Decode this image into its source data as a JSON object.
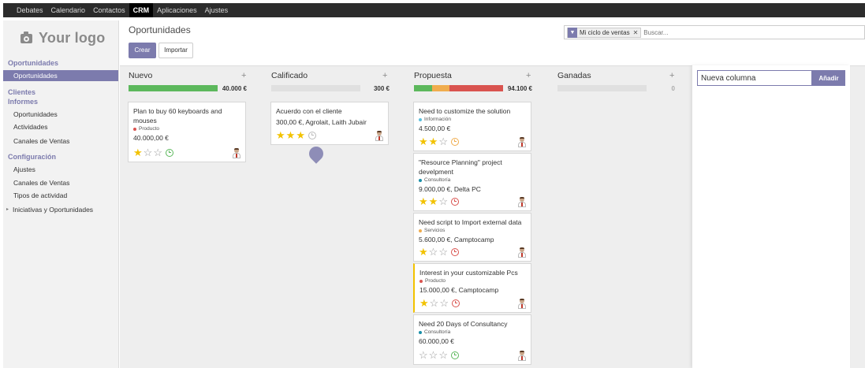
{
  "topnav": {
    "items": [
      "Debates",
      "Calendario",
      "Contactos",
      "CRM",
      "Aplicaciones",
      "Ajustes"
    ],
    "active": "CRM"
  },
  "sidebar": {
    "logo_text": "Your logo",
    "sections": {
      "oportunidades": "Oportunidades",
      "clientes": "Clientes",
      "informes": "Informes",
      "configuracion": "Configuración"
    },
    "active_item": "Oportunidades",
    "informes_items": [
      "Oportunidades",
      "Actividades",
      "Canales de Ventas"
    ],
    "config_items": [
      "Ajustes",
      "Canales de Ventas",
      "Tipos de actividad"
    ],
    "expandable_item": "Iniciativas y Oportunidades"
  },
  "header": {
    "title": "Oportunidades",
    "create_label": "Crear",
    "import_label": "Importar"
  },
  "search": {
    "facet": "Mi ciclo de ventas",
    "facet_icon": "filter-icon",
    "placeholder": "Buscar..."
  },
  "columns": [
    {
      "title": "Nuevo",
      "sum": "40.000 €",
      "plus": "+"
    },
    {
      "title": "Calificado",
      "sum": "300 €",
      "plus": "+"
    },
    {
      "title": "Propuesta",
      "sum": "94.100 €",
      "plus": "+"
    },
    {
      "title": "Ganadas",
      "sum": "0",
      "plus": "+"
    }
  ],
  "progress": {
    "nuevo": [
      {
        "color": "#5cb85c",
        "fraction": 1.0
      }
    ],
    "calificado": [],
    "propuesta": [
      {
        "color": "#5cb85c",
        "fraction": 0.2
      },
      {
        "color": "#f0ad4e",
        "fraction": 0.2
      },
      {
        "color": "#d9534f",
        "fraction": 0.6
      }
    ],
    "ganadas": []
  },
  "cards": {
    "c1": {
      "title": "Plan to buy 60 keyboards and mouses",
      "tag": "Producto",
      "tag_color": "#d9534f",
      "amount": "40.000,00 €",
      "stars": 1,
      "activity_color": "#5cb85c"
    },
    "c2": {
      "title": "Acuerdo con el cliente",
      "amount": "300,00 €, Agrolait, Laith Jubair",
      "stars": 3,
      "activity_color": "#bbbbbb"
    },
    "c3": {
      "title": "Need to customize the solution",
      "tag": "Información",
      "tag_color": "#5bc0de",
      "amount": "4.500,00 €",
      "stars": 2,
      "activity_color": "#f0ad4e"
    },
    "c4": {
      "title": "\"Resource Planning\" project develpment",
      "tag": "Consultoría",
      "tag_color": "#1a8fa8",
      "amount": "9.000,00 €, Delta PC",
      "stars": 2,
      "activity_color": "#d9534f"
    },
    "c5": {
      "title": "Need script to Import external data",
      "tag": "Servicios",
      "tag_color": "#f0ad4e",
      "amount": "5.600,00 €, Camptocamp",
      "stars": 1,
      "activity_color": "#d9534f"
    },
    "c6": {
      "title": "Interest in your customizable Pcs",
      "tag": "Producto",
      "tag_color": "#d9534f",
      "amount": "15.000,00 €, Camptocamp",
      "stars": 1,
      "activity_color": "#d9534f"
    },
    "c7": {
      "title": "Need 20 Days of Consultancy",
      "tag": "Consultoría",
      "tag_color": "#1a8fa8",
      "amount": "60.000,00 €",
      "stars": 0,
      "activity_color": "#5cb85c"
    }
  },
  "new_column": {
    "value": "Nueva columna",
    "button": "Añadir"
  },
  "colors": {
    "accent": "#7c7bad",
    "star": "#f2c200",
    "topbar": "#2c2c2c"
  }
}
